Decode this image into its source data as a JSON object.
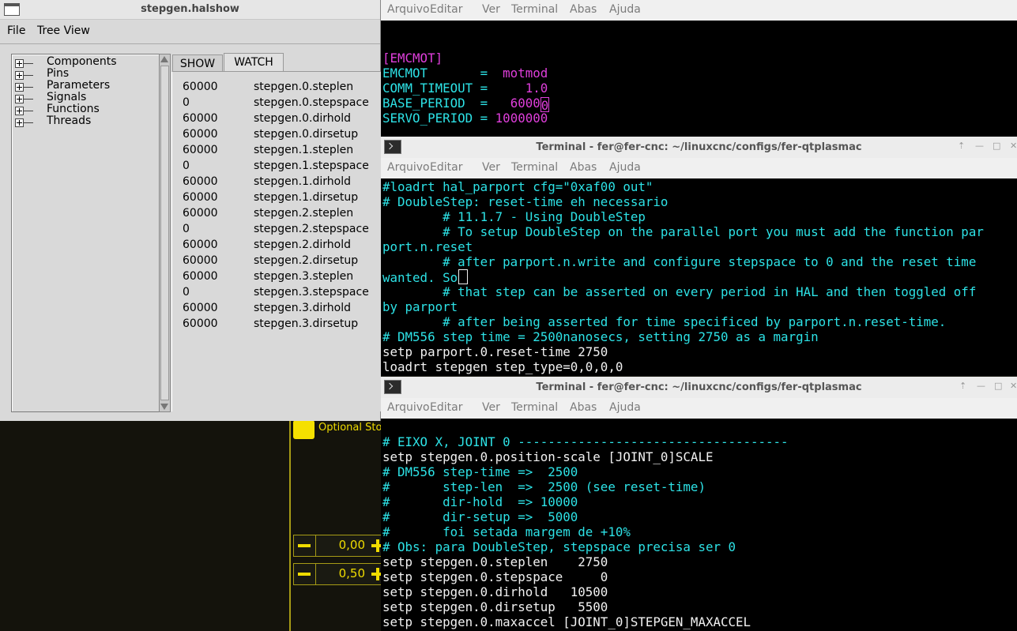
{
  "halshow": {
    "title": "stepgen.halshow",
    "menu": [
      "File",
      "Tree View"
    ],
    "tree": [
      "Components",
      "Pins",
      "Parameters",
      "Signals",
      "Functions",
      "Threads"
    ],
    "tabs": [
      "SHOW",
      "WATCH"
    ],
    "watch": [
      {
        "value": "60000",
        "name": "stepgen.0.steplen"
      },
      {
        "value": "0",
        "name": "stepgen.0.stepspace"
      },
      {
        "value": "60000",
        "name": "stepgen.0.dirhold"
      },
      {
        "value": "60000",
        "name": "stepgen.0.dirsetup"
      },
      {
        "value": "60000",
        "name": "stepgen.1.steplen"
      },
      {
        "value": "0",
        "name": "stepgen.1.stepspace"
      },
      {
        "value": "60000",
        "name": "stepgen.1.dirhold"
      },
      {
        "value": "60000",
        "name": "stepgen.1.dirsetup"
      },
      {
        "value": "60000",
        "name": "stepgen.2.steplen"
      },
      {
        "value": "0",
        "name": "stepgen.2.stepspace"
      },
      {
        "value": "60000",
        "name": "stepgen.2.dirhold"
      },
      {
        "value": "60000",
        "name": "stepgen.2.dirsetup"
      },
      {
        "value": "60000",
        "name": "stepgen.3.steplen"
      },
      {
        "value": "0",
        "name": "stepgen.3.stepspace"
      },
      {
        "value": "60000",
        "name": "stepgen.3.dirhold"
      },
      {
        "value": "60000",
        "name": "stepgen.3.dirsetup"
      }
    ]
  },
  "plasmac": {
    "optional_stop_label": "Optional Sto",
    "spin1_value": "0,00",
    "spin2_value": "0,50",
    "colors": {
      "accent": "#f0dc00",
      "background": "#14130c"
    }
  },
  "terminal_menu": [
    "Arquivo",
    "Editar",
    "Ver",
    "Terminal",
    "Abas",
    "Ajuda"
  ],
  "term1": {
    "lines": [
      {
        "text": "",
        "color": "white"
      },
      {
        "text": "[EMCMOT]",
        "color": "mag"
      },
      {
        "parts": [
          {
            "text": "EMCMOT       =  ",
            "color": "cyan"
          },
          {
            "text": "motmod",
            "color": "mag"
          }
        ]
      },
      {
        "parts": [
          {
            "text": "COMM_TIMEOUT =     ",
            "color": "cyan"
          },
          {
            "text": "1.0",
            "color": "mag"
          }
        ]
      },
      {
        "parts": [
          {
            "text": "BASE_PERIOD  =   ",
            "color": "cyan"
          },
          {
            "text": "6000",
            "color": "mag"
          },
          {
            "text": "0",
            "color": "mag",
            "cursor": true
          }
        ]
      },
      {
        "parts": [
          {
            "text": "SERVO_PERIOD = ",
            "color": "cyan"
          },
          {
            "text": "1000000",
            "color": "mag"
          }
        ]
      }
    ]
  },
  "term2": {
    "title": "Terminal - fer@fer-cnc: ~/linuxcnc/configs/fer-qtplasmac",
    "lines": [
      {
        "text": "#loadrt hal_parport cfg=\"0xaf00 out\"",
        "color": "cyan"
      },
      {
        "text": "# DoubleStep: reset-time eh necessario",
        "color": "cyan"
      },
      {
        "text": "        # 11.1.7 - Using DoubleStep",
        "color": "cyan"
      },
      {
        "text": "        # To setup DoubleStep on the parallel port you must add the function par",
        "color": "cyan"
      },
      {
        "text": "port.n.reset",
        "color": "cyan"
      },
      {
        "text": "        # after parport.n.write and configure stepspace to 0 and the reset time",
        "color": "cyan"
      },
      {
        "text": "wanted. So",
        "color": "cyan",
        "cursor": true
      },
      {
        "text": "        # that step can be asserted on every period in HAL and then toggled off",
        "color": "cyan"
      },
      {
        "text": "by parport",
        "color": "cyan"
      },
      {
        "text": "        # after being asserted for time specificed by parport.n.reset-time.",
        "color": "cyan"
      },
      {
        "text": "# DM556 step time = 2500nanosecs, setting 2750 as a margin",
        "color": "cyan"
      },
      {
        "text": "setp parport.0.reset-time 2750",
        "color": "white"
      },
      {
        "text": "loadrt stepgen step_type=0,0,0,0",
        "color": "white"
      }
    ]
  },
  "term3": {
    "title": "Terminal - fer@fer-cnc: ~/linuxcnc/configs/fer-qtplasmac",
    "lines": [
      {
        "text": "",
        "color": "white"
      },
      {
        "text": "# EIXO X, JOINT 0 ------------------------------------",
        "color": "cyan"
      },
      {
        "text": "setp stepgen.0.position-scale [JOINT_0]SCALE",
        "color": "white"
      },
      {
        "text": "# DM556 step-time =>  2500",
        "color": "cyan"
      },
      {
        "text": "#       step-len  =>  2500 (see reset-time)",
        "color": "cyan"
      },
      {
        "text": "#       dir-hold  => 10000",
        "color": "cyan"
      },
      {
        "text": "#       dir-setup =>  5000",
        "color": "cyan"
      },
      {
        "text": "#       foi setada margem de +10%",
        "color": "cyan"
      },
      {
        "text": "# Obs: para DoubleStep, stepspace precisa ser 0",
        "color": "cyan"
      },
      {
        "text": "setp stepgen.0.steplen    2750",
        "color": "white"
      },
      {
        "text": "setp stepgen.0.stepspace     0",
        "color": "white"
      },
      {
        "text": "setp stepgen.0.dirhold   10500",
        "color": "white"
      },
      {
        "text": "setp stepgen.0.dirsetup   5500",
        "color": "white"
      },
      {
        "text": "setp stepgen.0.maxaccel [JOINT_0]STEPGEN_MAXACCEL",
        "color": "white"
      }
    ]
  }
}
